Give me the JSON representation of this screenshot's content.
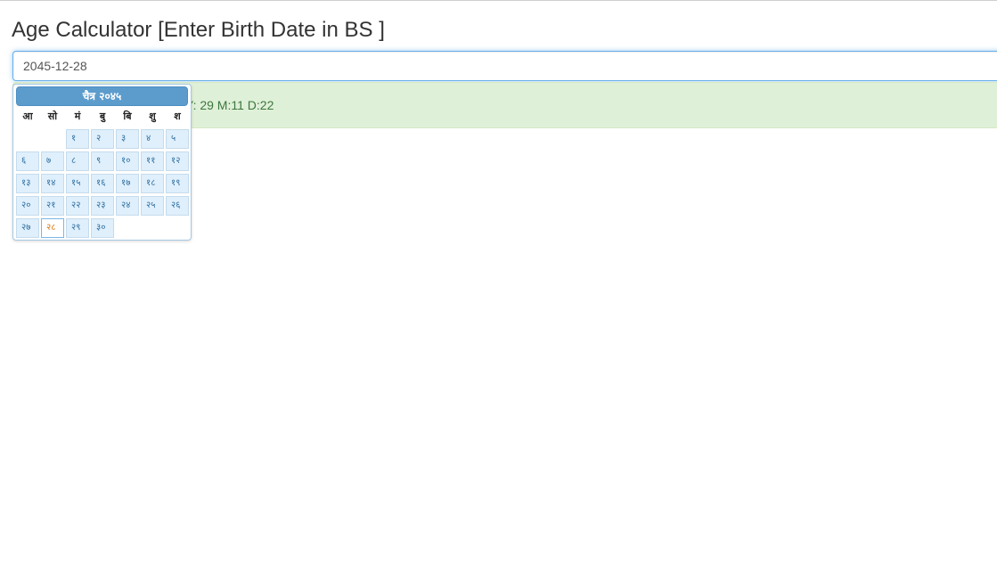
{
  "page": {
    "title": "Age Calculator [Enter Birth Date in BS ]"
  },
  "input": {
    "value": "2045-12-28"
  },
  "result": {
    "text": "Y: 29 M:11 D:22"
  },
  "calendar": {
    "month_year": "चैत्र २०४५",
    "weekdays": [
      "आ",
      "सो",
      "मं",
      "बु",
      "बि",
      "शु",
      "श"
    ],
    "days": [
      "१",
      "२",
      "३",
      "४",
      "५",
      "६",
      "७",
      "८",
      "९",
      "१०",
      "११",
      "१२",
      "१३",
      "१४",
      "१५",
      "१६",
      "१७",
      "१८",
      "१९",
      "२०",
      "२१",
      "२२",
      "२३",
      "२४",
      "२५",
      "२६",
      "२७",
      "२८",
      "२९",
      "३०"
    ],
    "first_weekday_index": 2,
    "selected_day": "२८",
    "colors": {
      "header_bg": "#5c9ccc",
      "day_bg": "#dfeffc",
      "day_text": "#2e6e9e",
      "selected_text": "#e17009"
    }
  }
}
